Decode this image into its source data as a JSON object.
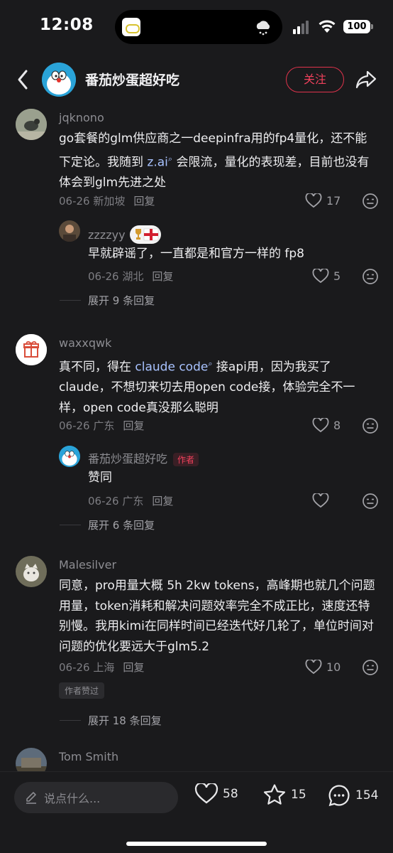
{
  "status_bar": {
    "time": "12:08",
    "battery": "100"
  },
  "nav": {
    "title": "番茄炒蛋超好吃",
    "follow_label": "关注"
  },
  "comments": [
    {
      "user": "jqknono",
      "text_parts": [
        "go套餐的glm供应商之一deepinfra用的fp4量化，还不能下定论。我随到 ",
        "z.ai",
        " 会限流，量化的表现差，目前也没有体会到glm先进之处"
      ],
      "date_loc": "06-26 新加坡",
      "reply_label": "回复",
      "likes": "17",
      "replies": [
        {
          "user": "zzzzyy",
          "text": "早就辟谣了，一直都是和官方一样的 fp8",
          "date_loc": "06-26 湖北",
          "reply_label": "回复",
          "likes": "5"
        }
      ],
      "expand_label": "展开 9 条回复"
    },
    {
      "user": "waxxqwk",
      "text_parts": [
        "真不同，得在 ",
        "claude code",
        " 接api用，因为我买了claude，不想切来切去用open code接，体验完全不一样，open code真没那么聪明"
      ],
      "date_loc": "06-26 广东",
      "reply_label": "回复",
      "likes": "8",
      "replies": [
        {
          "user": "番茄炒蛋超好吃",
          "author_tag": "作者",
          "text": "赞同",
          "date_loc": "06-26 广东",
          "reply_label": "回复",
          "likes": ""
        }
      ],
      "expand_label": "展开 6 条回复"
    },
    {
      "user": "Malesilver",
      "text": "同意，pro用量大概 5h 2kw tokens，高峰期也就几个问题用量，token消耗和解决问题效率完全不成正比，速度还特别慢。我用kimi在同样时间已经迭代好几轮了，单位时间对问题的优化要远大于glm5.2",
      "date_loc": "06-26 上海",
      "reply_label": "回复",
      "likes": "10",
      "praised_label": "作者赞过",
      "expand_label": "展开 18 条回复"
    },
    {
      "user": "Tom Smith"
    }
  ],
  "bottom": {
    "placeholder": "说点什么...",
    "likes": "58",
    "stars": "15",
    "comments": "154"
  }
}
